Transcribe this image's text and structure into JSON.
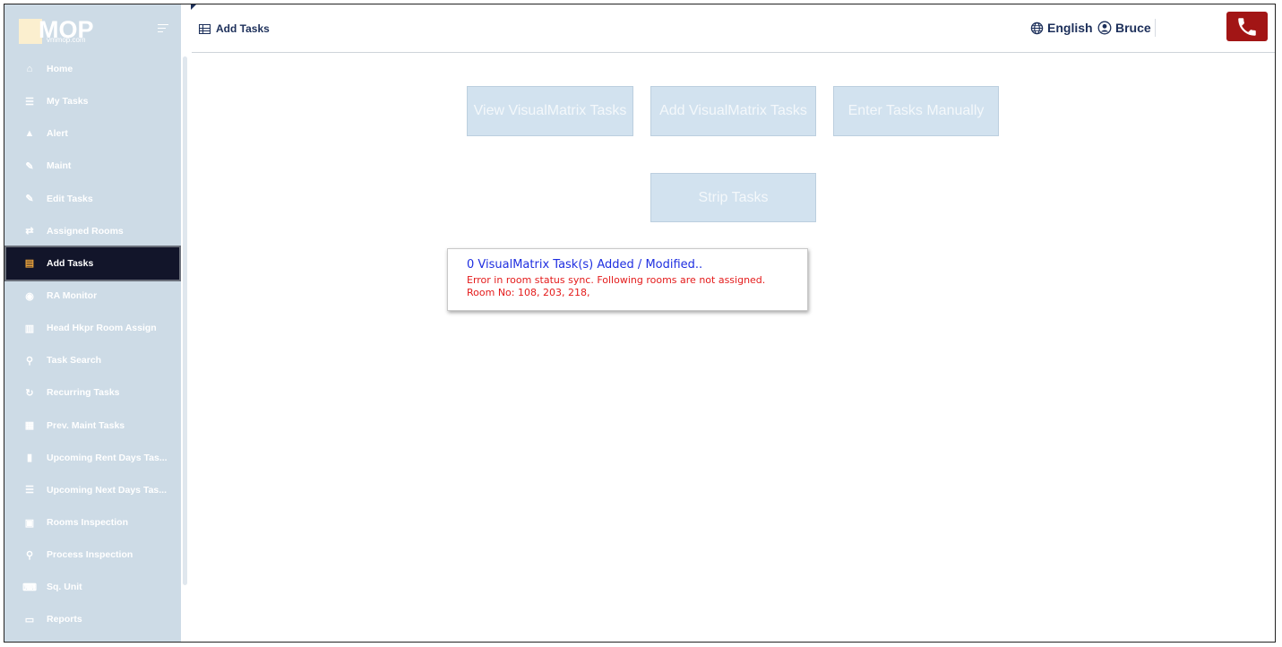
{
  "logo": {
    "text": "MOP",
    "sub": "vmmop.com"
  },
  "sidebar": {
    "items": [
      {
        "label": "Home",
        "icon": "home-icon"
      },
      {
        "label": "My Tasks",
        "icon": "task-list-icon"
      },
      {
        "label": "Alert",
        "icon": "alert-icon"
      },
      {
        "label": "Maint",
        "icon": "wrench-icon"
      },
      {
        "label": "Edit Tasks",
        "icon": "edit-icon"
      },
      {
        "label": "Assigned Rooms",
        "icon": "swap-icon"
      },
      {
        "label": "Add Tasks",
        "icon": "table-icon",
        "active": true
      },
      {
        "label": "RA Monitor",
        "icon": "binoculars-icon"
      },
      {
        "label": "Head Hkpr Room Assign",
        "icon": "building-icon"
      },
      {
        "label": "Task Search",
        "icon": "search-icon"
      },
      {
        "label": "Recurring Tasks",
        "icon": "refresh-icon"
      },
      {
        "label": "Prev. Maint Tasks",
        "icon": "calendar-icon"
      },
      {
        "label": "Upcoming Rent Days Tas...",
        "icon": "clipboard-icon"
      },
      {
        "label": "Upcoming Next Days Tas...",
        "icon": "list-icon"
      },
      {
        "label": "Rooms Inspection",
        "icon": "room-icon"
      },
      {
        "label": "Process Inspection",
        "icon": "magnify-icon"
      },
      {
        "label": "Sq. Unit",
        "icon": "keyboard-icon"
      },
      {
        "label": "Reports",
        "icon": "report-icon"
      }
    ]
  },
  "header": {
    "title": "Add Tasks",
    "language": "English",
    "user": "Bruce"
  },
  "actions": {
    "view_vm": "View VisualMatrix Tasks",
    "add_vm": "Add VisualMatrix Tasks",
    "enter_manual": "Enter Tasks Manually",
    "strip": "Strip Tasks"
  },
  "message": {
    "line1": "0 VisualMatrix Task(s) Added / Modified..",
    "line2": "Error in room status sync. Following rooms are not assigned.",
    "line3": "Room No: 108, 203, 218,"
  },
  "colors": {
    "sidebar": "#cddbe6",
    "active": "#12152a",
    "accent": "#e8a13a",
    "phone": "#a21515",
    "navy": "#1c2f5a"
  }
}
